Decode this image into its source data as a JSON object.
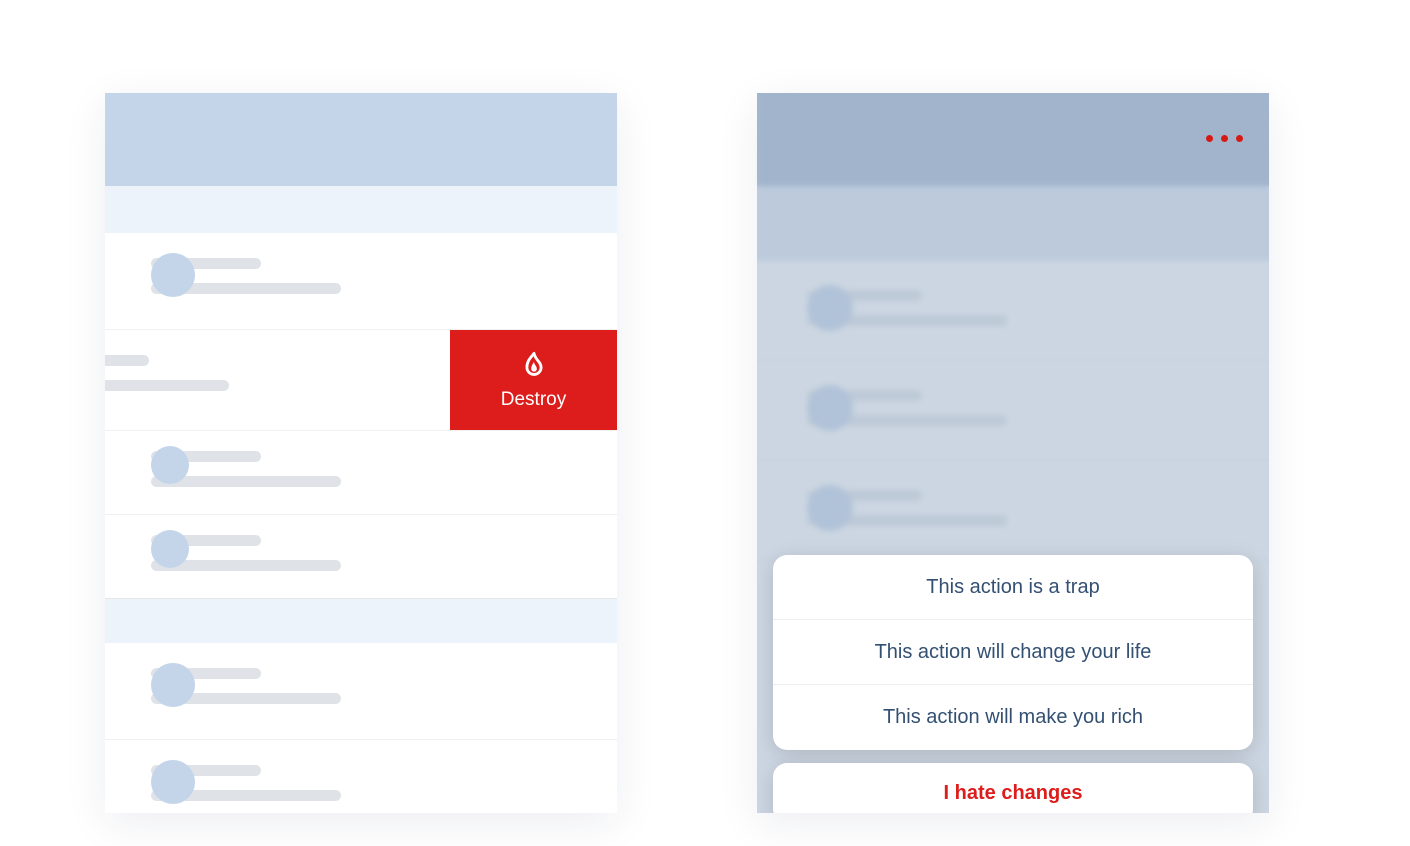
{
  "left": {
    "destroy_label": "Destroy"
  },
  "right": {
    "sheet_options": [
      "This action is a trap",
      "This action will change your life",
      "This action will make you rich"
    ],
    "cancel_label": "I hate changes"
  },
  "colors": {
    "destructive": "#dd1d1b",
    "header": "#c4d5ea",
    "text": "#335072"
  },
  "icons": {
    "destroy": "flame-icon",
    "menu": "more-icon"
  }
}
